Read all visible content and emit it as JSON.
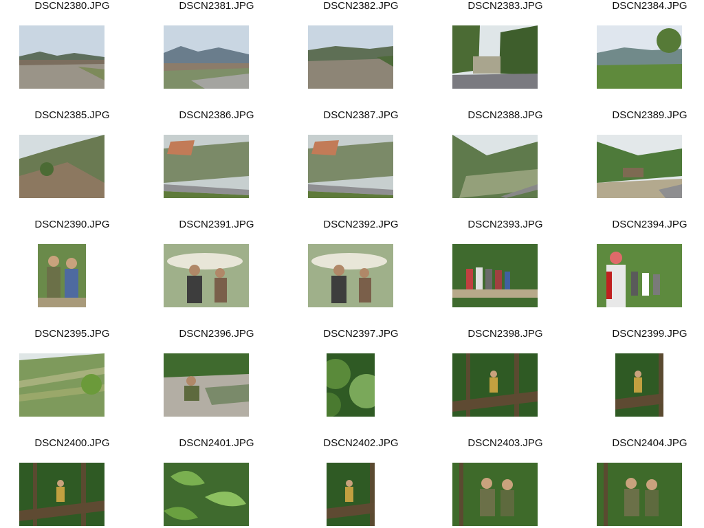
{
  "photos": [
    {
      "filename": "DSCN2380.JPG",
      "scene": "river-town",
      "orientation": "landscape"
    },
    {
      "filename": "DSCN2381.JPG",
      "scene": "town-hills",
      "orientation": "landscape"
    },
    {
      "filename": "DSCN2382.JPG",
      "scene": "river-valley",
      "orientation": "landscape"
    },
    {
      "filename": "DSCN2383.JPG",
      "scene": "river-trees",
      "orientation": "landscape"
    },
    {
      "filename": "DSCN2384.JPG",
      "scene": "mountain-view",
      "orientation": "landscape"
    },
    {
      "filename": "DSCN2385.JPG",
      "scene": "hillside",
      "orientation": "landscape"
    },
    {
      "filename": "DSCN2386.JPG",
      "scene": "road-valley",
      "orientation": "landscape"
    },
    {
      "filename": "DSCN2387.JPG",
      "scene": "road-valley",
      "orientation": "landscape"
    },
    {
      "filename": "DSCN2388.JPG",
      "scene": "valley-road",
      "orientation": "landscape"
    },
    {
      "filename": "DSCN2389.JPG",
      "scene": "hut-road",
      "orientation": "landscape"
    },
    {
      "filename": "DSCN2390.JPG",
      "scene": "two-people",
      "orientation": "portrait"
    },
    {
      "filename": "DSCN2391.JPG",
      "scene": "porters",
      "orientation": "landscape"
    },
    {
      "filename": "DSCN2392.JPG",
      "scene": "porters",
      "orientation": "landscape"
    },
    {
      "filename": "DSCN2393.JPG",
      "scene": "group-bridge",
      "orientation": "landscape"
    },
    {
      "filename": "DSCN2394.JPG",
      "scene": "hikers-forest",
      "orientation": "landscape"
    },
    {
      "filename": "DSCN2395.JPG",
      "scene": "terraces",
      "orientation": "landscape"
    },
    {
      "filename": "DSCN2396.JPG",
      "scene": "stream-rock",
      "orientation": "landscape"
    },
    {
      "filename": "DSCN2397.JPG",
      "scene": "jungle",
      "orientation": "portrait"
    },
    {
      "filename": "DSCN2398.JPG",
      "scene": "jungle-person",
      "orientation": "landscape"
    },
    {
      "filename": "DSCN2399.JPG",
      "scene": "jungle-person",
      "orientation": "portrait"
    },
    {
      "filename": "DSCN2400.JPG",
      "scene": "jungle-person",
      "orientation": "landscape"
    },
    {
      "filename": "DSCN2401.JPG",
      "scene": "leaves",
      "orientation": "landscape"
    },
    {
      "filename": "DSCN2402.JPG",
      "scene": "jungle-person",
      "orientation": "portrait"
    },
    {
      "filename": "DSCN2403.JPG",
      "scene": "two-people-forest",
      "orientation": "landscape"
    },
    {
      "filename": "DSCN2404.JPG",
      "scene": "two-people-forest",
      "orientation": "landscape"
    }
  ]
}
